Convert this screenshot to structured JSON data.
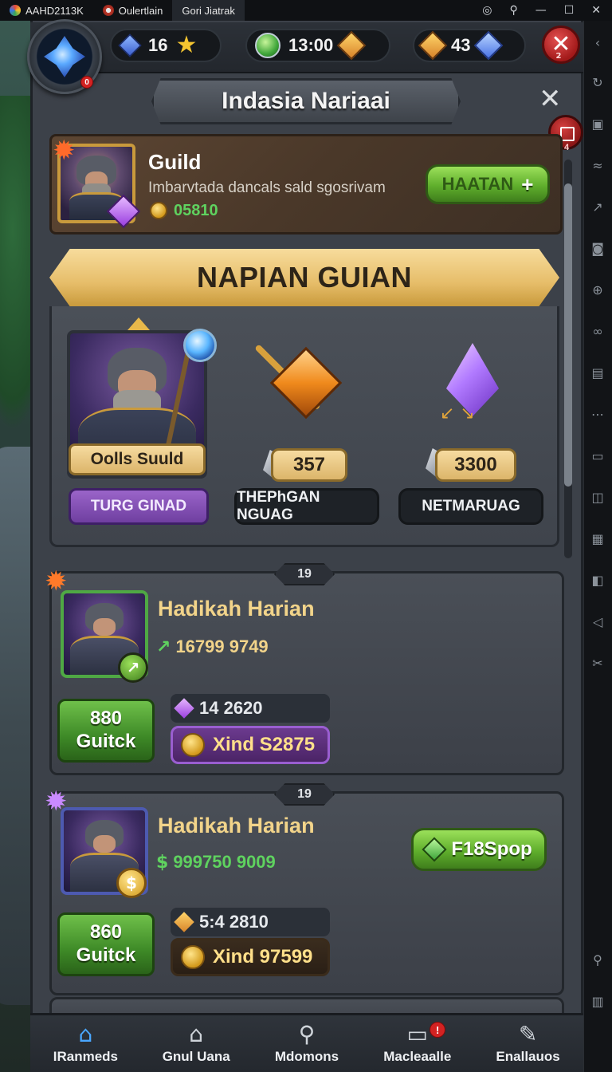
{
  "os_bar": {
    "tabs": [
      {
        "label": "AAHD2113K"
      },
      {
        "label": "Oulertlain"
      },
      {
        "label": "Gori Jiatrak"
      }
    ],
    "controls": [
      "◎",
      "⚲",
      "—",
      "☐",
      "✕"
    ]
  },
  "resources": {
    "avatar_badge": "0",
    "pill1_value": "16",
    "pill2_value": "13:00",
    "pill3_value": "43",
    "close_badge": "2"
  },
  "header": {
    "title": "Indasia Nariaai",
    "close_label": "✕",
    "side_badge": "4"
  },
  "guild": {
    "name": "Guild",
    "description": "Imbarvtada dancals sald sgosrivam",
    "coins": "05810",
    "action_label": "HAATAN",
    "action_icon": "+"
  },
  "banner": {
    "title": "NAPIAN GUIAN"
  },
  "rewards": {
    "hero_name": "Oolls Suuld",
    "item1_qty": "357",
    "item2_qty": "3300",
    "tab1": "TURG GINAD",
    "tab2": "THEPhGAN NGUAG",
    "tab3": "NETMARUAG"
  },
  "events": [
    {
      "tag": "19",
      "title": "Hadikah Harian",
      "stat_icon": "↗",
      "stat": "16799 9749",
      "box_top": "880",
      "box_bottom": "Guitck",
      "row_value": "14 2620",
      "coin_text": "Xind S2875"
    },
    {
      "tag": "19",
      "title": "Hadikah Harian",
      "stat_icon": "$",
      "stat": "999750 9009",
      "box_top": "860",
      "box_bottom": "Guitck",
      "row_value": "5:4 2810",
      "coin_text": "Xind 97599",
      "action_label": "F18Spop"
    }
  ],
  "nav": [
    {
      "label": "IRanmeds",
      "icon": "⌂"
    },
    {
      "label": "Gnul Uana",
      "icon": "⌂"
    },
    {
      "label": "Mdomons",
      "icon": "⚲"
    },
    {
      "label": "Macleaalle",
      "icon": "▭",
      "badge": "!"
    },
    {
      "label": "Enallauos",
      "icon": "✎"
    }
  ],
  "colors": {
    "accent_green": "#5fae2c",
    "gold": "#e6bd69",
    "purple": "#6f3fa0",
    "panel": "#3c4048"
  }
}
